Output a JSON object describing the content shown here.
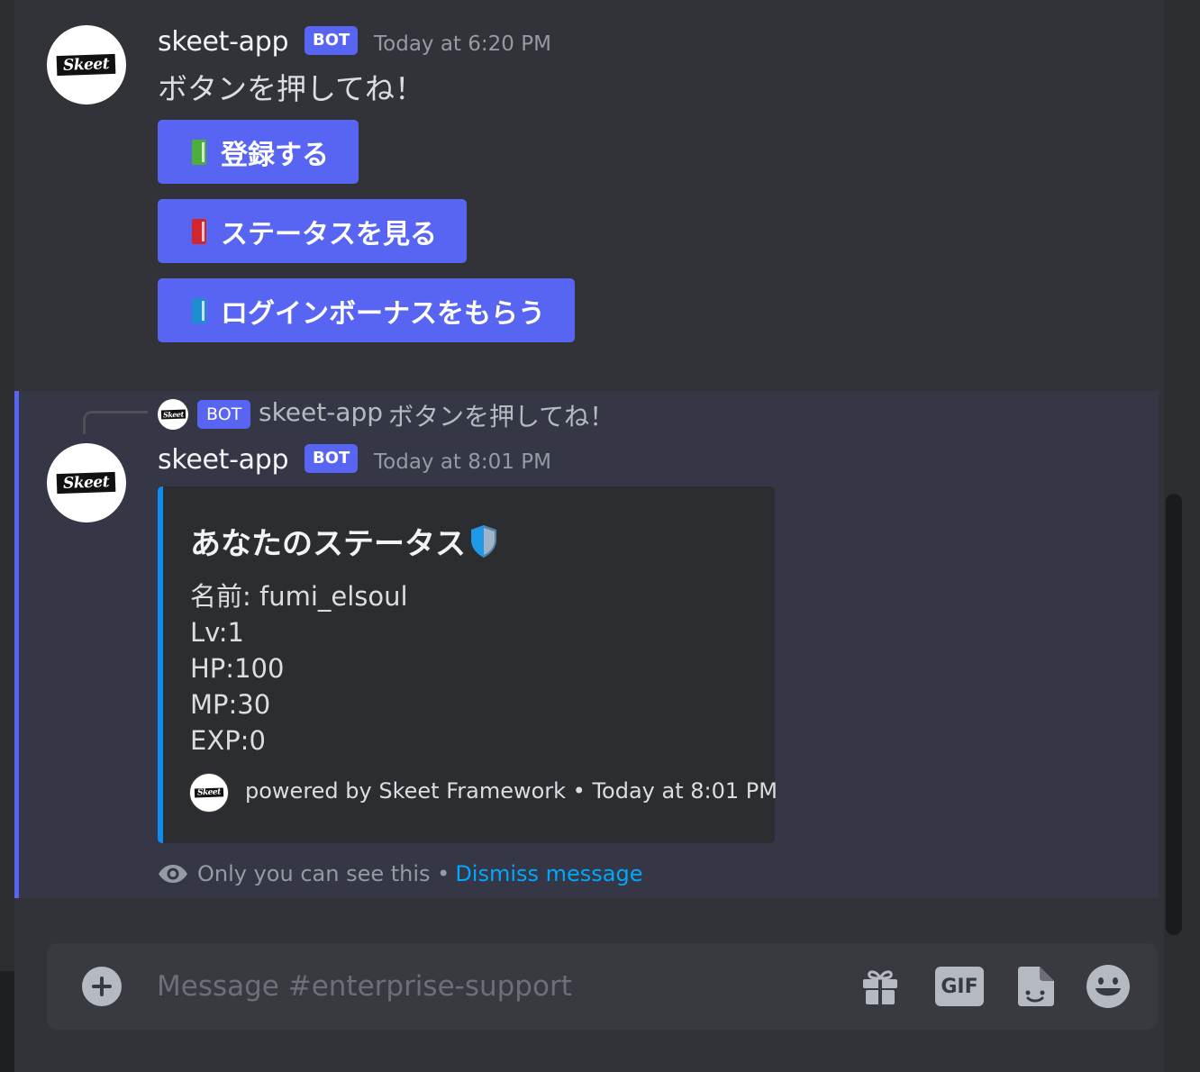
{
  "message1": {
    "username": "skeet-app",
    "bot_tag": "BOT",
    "timestamp": "Today at 6:20 PM",
    "avatar_logo": "Skeet",
    "text": "ボタンを押してね！",
    "buttons": [
      {
        "label": "登録する",
        "icon": "green-book-icon",
        "color": "#4caf3b"
      },
      {
        "label": "ステータスを見る",
        "icon": "red-book-icon",
        "color": "#d3262c"
      },
      {
        "label": "ログインボーナスをもらう",
        "icon": "blue-book-icon",
        "color": "#1d8fd1"
      }
    ]
  },
  "message2": {
    "reply": {
      "bot_tag": "BOT",
      "username": "skeet-app",
      "text": "ボタンを押してね！"
    },
    "username": "skeet-app",
    "bot_tag": "BOT",
    "timestamp": "Today at 8:01 PM",
    "avatar_logo": "Skeet",
    "embed": {
      "title": "あなたのステータス",
      "title_icon": "shield-icon",
      "accent_color": "#0d8df0",
      "lines": [
        "名前: fumi_elsoul",
        "Lv:1",
        "HP:100",
        "MP:30",
        "EXP:0"
      ],
      "footer_text": "powered by Skeet Framework • Today at 8:01 PM"
    },
    "ephemeral": {
      "notice": "Only you can see this •",
      "dismiss_label": "Dismiss message"
    }
  },
  "composer": {
    "placeholder": "Message #enterprise-support",
    "gif_label": "GIF"
  },
  "colors": {
    "background": "#313338",
    "blurple": "#5865f2",
    "link": "#00a8fc",
    "highlight": "#353746"
  }
}
